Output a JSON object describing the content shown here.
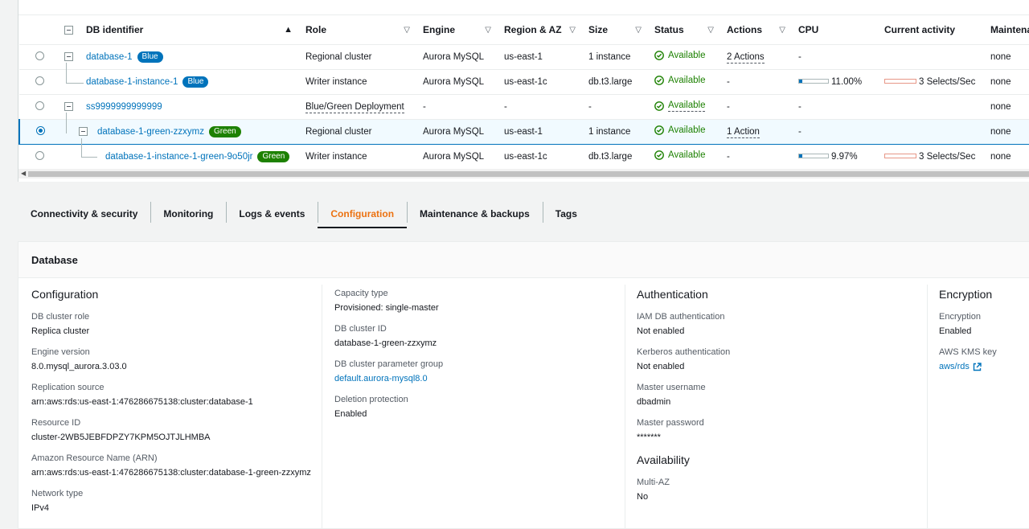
{
  "table": {
    "headers": {
      "identifier": "DB identifier",
      "role": "Role",
      "engine": "Engine",
      "region": "Region & AZ",
      "size": "Size",
      "status": "Status",
      "actions": "Actions",
      "cpu": "CPU",
      "activity": "Current activity",
      "maintenance": "Maintenan"
    },
    "rows": [
      {
        "id": "database-1",
        "badge": "Blue",
        "role": "Regional cluster",
        "engine": "Aurora MySQL",
        "region": "us-east-1",
        "size": "1 instance",
        "status": "Available",
        "actions": "2 Actions",
        "cpu": "-",
        "activity": "",
        "maintenance": "none"
      },
      {
        "id": "database-1-instance-1",
        "badge": "Blue",
        "role": "Writer instance",
        "engine": "Aurora MySQL",
        "region": "us-east-1c",
        "size": "db.t3.large",
        "status": "Available",
        "actions": "-",
        "cpu": "11.00%",
        "cpu_level": 0.11,
        "activity": "3 Selects/Sec",
        "maintenance": "none"
      },
      {
        "id": "ss9999999999999",
        "badge": "",
        "role": "Blue/Green Deployment",
        "engine": "-",
        "region": "-",
        "size": "-",
        "status": "Available",
        "actions": "-",
        "cpu": "-",
        "activity": "",
        "maintenance": "none"
      },
      {
        "id": "database-1-green-zzxymz",
        "badge": "Green",
        "role": "Regional cluster",
        "engine": "Aurora MySQL",
        "region": "us-east-1",
        "size": "1 instance",
        "status": "Available",
        "actions": "1 Action",
        "cpu": "-",
        "activity": "",
        "maintenance": "none"
      },
      {
        "id": "database-1-instance-1-green-9o50jr",
        "badge": "Green",
        "role": "Writer instance",
        "engine": "Aurora MySQL",
        "region": "us-east-1c",
        "size": "db.t3.large",
        "status": "Available",
        "actions": "-",
        "cpu": "9.97%",
        "cpu_level": 0.0997,
        "activity": "3 Selects/Sec",
        "maintenance": "none"
      }
    ]
  },
  "tabs": [
    "Connectivity & security",
    "Monitoring",
    "Logs & events",
    "Configuration",
    "Maintenance & backups",
    "Tags"
  ],
  "active_tab": "Configuration",
  "panel": {
    "title": "Database",
    "col1": {
      "heading": "Configuration",
      "items": [
        {
          "k": "DB cluster role",
          "v": "Replica cluster"
        },
        {
          "k": "Engine version",
          "v": "8.0.mysql_aurora.3.03.0"
        },
        {
          "k": "Replication source",
          "v": "arn:aws:rds:us-east-1:476286675138:cluster:database-1"
        },
        {
          "k": "Resource ID",
          "v": "cluster-2WB5JEBFDPZY7KPM5OJTJLHMBA"
        },
        {
          "k": "Amazon Resource Name (ARN)",
          "v": "arn:aws:rds:us-east-1:476286675138:cluster:database-1-green-zzxymz"
        },
        {
          "k": "Network type",
          "v": "IPv4"
        }
      ]
    },
    "col2": {
      "items": [
        {
          "k": "Capacity type",
          "v": "Provisioned: single-master"
        },
        {
          "k": "DB cluster ID",
          "v": "database-1-green-zzxymz"
        },
        {
          "k": "DB cluster parameter group",
          "v": "default.aurora-mysql8.0"
        },
        {
          "k": "Deletion protection",
          "v": "Enabled"
        }
      ]
    },
    "col3": {
      "heading": "Authentication",
      "items": [
        {
          "k": "IAM DB authentication",
          "v": "Not enabled"
        },
        {
          "k": "Kerberos authentication",
          "v": "Not enabled"
        },
        {
          "k": "Master username",
          "v": "dbadmin"
        },
        {
          "k": "Master password",
          "v": "*******"
        }
      ],
      "heading2": "Availability",
      "items2": [
        {
          "k": "Multi-AZ",
          "v": "No"
        }
      ]
    },
    "col4": {
      "heading": "Encryption",
      "items": [
        {
          "k": "Encryption",
          "v": "Enabled"
        },
        {
          "k": "AWS KMS key",
          "v": "aws/rds"
        }
      ]
    }
  },
  "colors": {
    "link": "#0073bb",
    "available": "#1d8102",
    "active_tab": "#ec7211",
    "blue_badge": "#0073bb",
    "green_badge": "#1d8102"
  }
}
